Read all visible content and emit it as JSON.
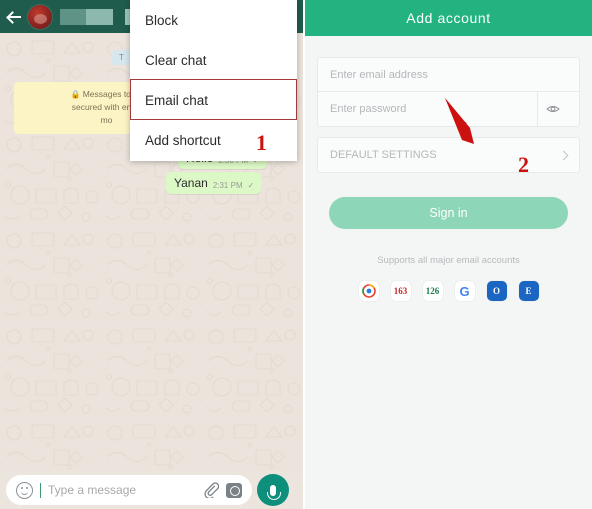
{
  "left_panel": {
    "topbar": {
      "back_icon": "back-arrow-icon",
      "avatar": "contact-avatar",
      "name_redacted": true
    },
    "date_chip": "T",
    "encryption_notice": "🔒 Messages to thi\nsecured with end-t\nmo",
    "messages": [
      {
        "text": "Hello",
        "time": "2:30 PM",
        "tick": "✓"
      },
      {
        "text": "Yanan",
        "time": "2:31 PM",
        "tick": "✓"
      }
    ],
    "input_bar": {
      "emoji_icon": "smiley-icon",
      "placeholder": "Type a message",
      "attach_icon": "paperclip-icon",
      "camera_icon": "camera-icon",
      "mic_icon": "microphone-icon"
    }
  },
  "context_menu": {
    "items": [
      {
        "label": "Block",
        "highlighted": false
      },
      {
        "label": "Clear chat",
        "highlighted": false
      },
      {
        "label": "Email chat",
        "highlighted": true
      },
      {
        "label": "Add shortcut",
        "highlighted": false
      }
    ]
  },
  "annotations": {
    "step_one": "1",
    "step_two": "2",
    "arrow_color": "#cc1111",
    "highlight_color": "#a33a3a"
  },
  "right_panel": {
    "header_title": "Add  account",
    "email_field": {
      "placeholder": "Enter email address",
      "value": ""
    },
    "password_field": {
      "placeholder": "Enter password",
      "value": "",
      "reveal_icon": "eye-icon"
    },
    "default_settings": {
      "label": "DEFAULT SETTINGS",
      "chevron_icon": "chevron-right-icon"
    },
    "sign_in_button": {
      "label": "Sign in",
      "enabled": false
    },
    "supports_text": "Supports all major email accounts",
    "providers": [
      {
        "name": "qq-mail-icon",
        "label": ""
      },
      {
        "name": "163-mail-icon",
        "label": "163"
      },
      {
        "name": "126-mail-icon",
        "label": "126"
      },
      {
        "name": "gmail-icon",
        "label": "G"
      },
      {
        "name": "outlook-icon",
        "label": "O"
      },
      {
        "name": "exchange-icon",
        "label": "E"
      }
    ]
  },
  "colors": {
    "whatsapp_topbar": "#1f5c4d",
    "chat_wallpaper": "#ece4dc",
    "outgoing_bubble": "#dcf8c6",
    "accent_green": "#22b381",
    "signin_disabled": "#8dd6b8",
    "mic_button": "#0d8f7b"
  }
}
